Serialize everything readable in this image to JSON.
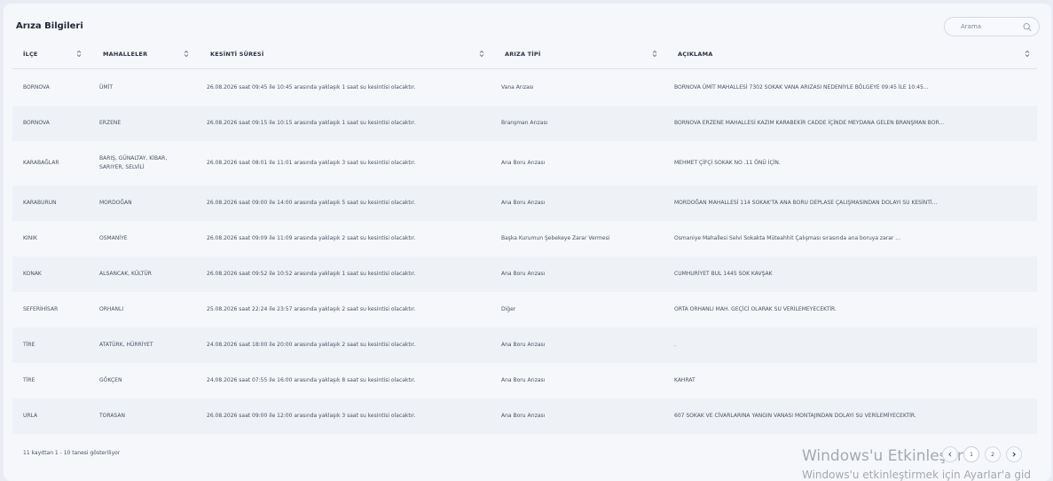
{
  "title": "Arıza Bilgileri",
  "search": {
    "placeholder": "Arama"
  },
  "headers": {
    "ilce": "İLÇE",
    "mahalleler": "MAHALLELER",
    "kesinti": "KESİNTİ SÜRESİ",
    "tip": "ARIZA TİPİ",
    "aciklama": "AÇIKLAMA"
  },
  "rows": [
    {
      "ilce": "BORNOVA",
      "mahalleler": "ÜMİT",
      "kesinti": "26.08.2026 saat 09:45 ile 10:45 arasında yaklaşık 1 saat su kesintisi olacaktır.",
      "tip": "Vana Arızası",
      "aciklama": "BORNOVA ÜMİT MAHALLESİ 7302 SOKAK VANA ARIZASI NEDENİYLE BÖLGEYE 09:45 İLE 10:45..."
    },
    {
      "ilce": "BORNOVA",
      "mahalleler": "ERZENE",
      "kesinti": "26.08.2026 saat 09:15 ile 10:15 arasında yaklaşık 1 saat su kesintisi olacaktır.",
      "tip": "Branşman Arızası",
      "aciklama": "BORNOVA ERZENE MAHALLESİ KAZIM KARABEKİR CADDE İÇİNDE MEYDANA GELEN BRANŞMAN BOR..."
    },
    {
      "ilce": "KARABAĞLAR",
      "mahalleler": "BARIŞ, GÜNALTAY, KİBAR, SARIYER, SELVİLİ",
      "kesinti": "26.08.2026 saat 08:01 ile 11:01 arasında yaklaşık 3 saat su kesintisi olacaktır.",
      "tip": "Ana Boru Arızası",
      "aciklama": "MEHMET ÇİFÇİ SOKAK NO .11 ÖNÜ İÇİN."
    },
    {
      "ilce": "KARABURUN",
      "mahalleler": "MORDOĞAN",
      "kesinti": "26.08.2026 saat 09:00 ile 14:00 arasında yaklaşık 5 saat su kesintisi olacaktır.",
      "tip": "Ana Boru Arızası",
      "aciklama": "MORDOĞAN MAHALLESİ 114 SOKAK'TA ANA BORU DEPLASE ÇALIŞMASINDAN DOLAYI SU KESİNTİ..."
    },
    {
      "ilce": "KINIK",
      "mahalleler": "OSMANİYE",
      "kesinti": "26.08.2026 saat 09:09 ile 11:09 arasında yaklaşık 2 saat su kesintisi olacaktır.",
      "tip": "Başka Kurumun Şebekeye Zarar Vermesi",
      "aciklama": "Osmaniye Mahallesi Selvi Sokakta Müteahhit Çalışması sırasında ana boruya zarar ..."
    },
    {
      "ilce": "KONAK",
      "mahalleler": "ALSANCAK, KÜLTÜR",
      "kesinti": "26.08.2026 saat 09:52 ile 10:52 arasında yaklaşık 1 saat su kesintisi olacaktır.",
      "tip": "Ana Boru Arızası",
      "aciklama": "CUMHURİYET BUL 1445 SOK KAVŞAK"
    },
    {
      "ilce": "SEFERİHİSAR",
      "mahalleler": "ORHANLI",
      "kesinti": "25.08.2026 saat 22:24 ile 23:57 arasında yaklaşık 2 saat su kesintisi olacaktır.",
      "tip": "Diğer",
      "aciklama": "ORTA ORHANLI MAH. GEÇİCİ OLARAK SU VERİLEMEYECEKTİR."
    },
    {
      "ilce": "TİRE",
      "mahalleler": "ATATÜRK, HÜRRİYET",
      "kesinti": "24.08.2026 saat 18:00 ile 20:00 arasında yaklaşık 2 saat su kesintisi olacaktır.",
      "tip": "Ana Boru Arızası",
      "aciklama": "."
    },
    {
      "ilce": "TİRE",
      "mahalleler": "GÖKÇEN",
      "kesinti": "24.08.2026 saat 07:55 ile 16:00 arasında yaklaşık 8 saat su kesintisi olacaktır.",
      "tip": "Ana Boru Arızası",
      "aciklama": "KAHRAT"
    },
    {
      "ilce": "URLA",
      "mahalleler": "TORASAN",
      "kesinti": "26.08.2026 saat 09:00 ile 12:00 arasında yaklaşık 3 saat su kesintisi olacaktır.",
      "tip": "Ana Boru Arızası",
      "aciklama": "607 SOKAK VE CİVARLARINA YANGIN VANASI MONTAJINDAN DOLAYI SU VERİLEMİYECEKTİR."
    }
  ],
  "footer": {
    "info": "11 kayıttan 1 - 10 tanesi gösteriliyor"
  },
  "pagination": {
    "pages": [
      "1",
      "2"
    ]
  },
  "watermark": {
    "line1": "Windows'u Etkinleştir",
    "line2": "Windows'u etkinleştirmek için Ayarlar'a gid"
  }
}
